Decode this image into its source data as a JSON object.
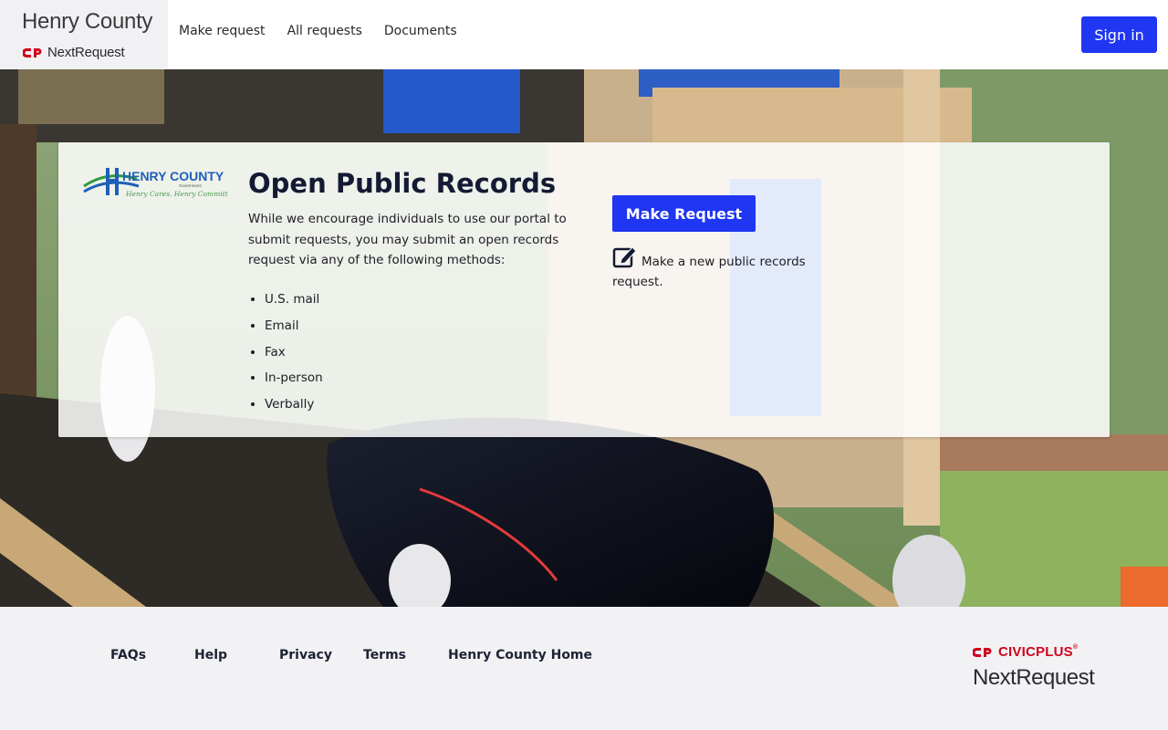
{
  "header": {
    "brand_title": "Henry County",
    "brand_product": "NextRequest",
    "nav": [
      {
        "label": "Make request"
      },
      {
        "label": "All requests"
      },
      {
        "label": "Documents"
      }
    ],
    "signin_label": "Sign in",
    "accent_color": "#1f36f2"
  },
  "hero": {
    "logo": {
      "text": "HENRY COUNTY",
      "sub": "Government",
      "tagline": "Henry Cares. Henry Committed."
    },
    "title": "Open Public Records",
    "intro": "While we encourage individuals to use our portal to submit requests, you may submit an open records request via any of the following methods:",
    "methods": [
      "U.S. mail",
      "Email",
      "Fax",
      "In-person",
      "Verbally"
    ],
    "make_request_label": "Make Request",
    "make_request_description": "Make a new public records request."
  },
  "footer": {
    "links": [
      {
        "label": "FAQs"
      },
      {
        "label": "Help"
      },
      {
        "label": "Privacy"
      },
      {
        "label": "Terms"
      },
      {
        "label": "Henry County Home"
      }
    ],
    "vendor": "CIVICPLUS",
    "vendor_tm": "®",
    "product": "NextRequest"
  }
}
